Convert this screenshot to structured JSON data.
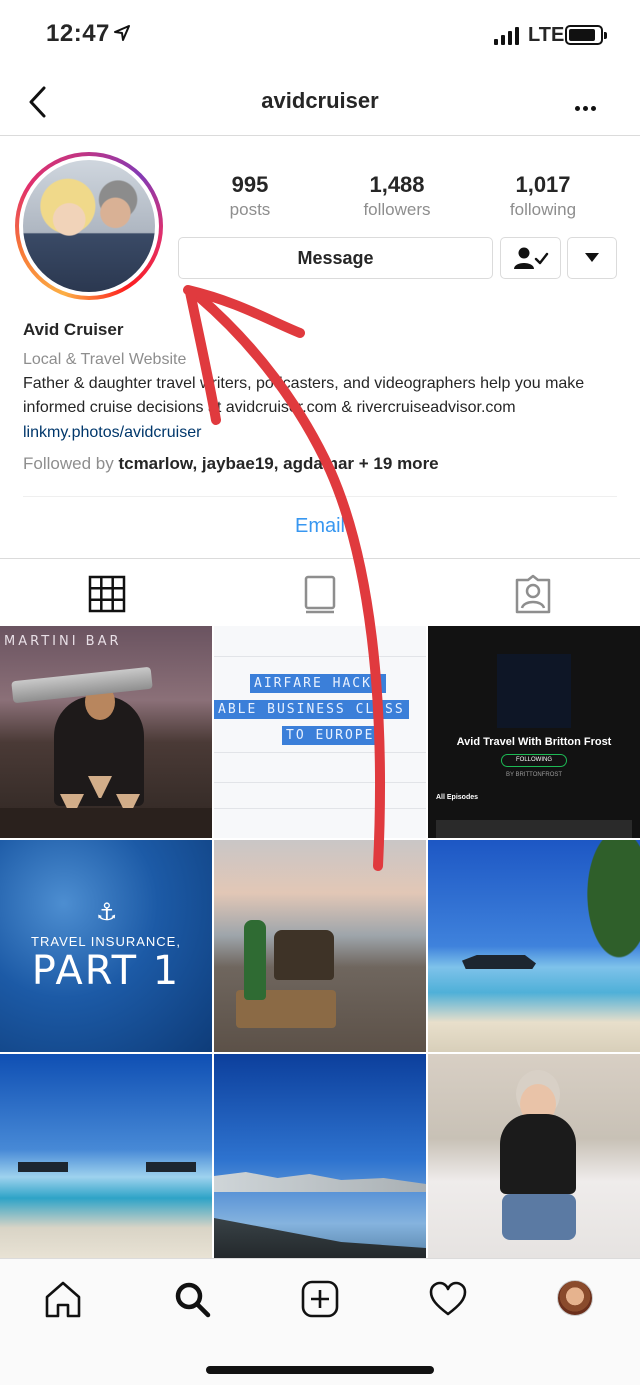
{
  "status_bar": {
    "time": "12:47",
    "network": "LTE"
  },
  "header": {
    "username": "avidcruiser"
  },
  "profile": {
    "stats": [
      {
        "value": "995",
        "label": "posts"
      },
      {
        "value": "1,488",
        "label": "followers"
      },
      {
        "value": "1,017",
        "label": "following"
      }
    ],
    "message_label": "Message",
    "name": "Avid Cruiser",
    "category": "Local & Travel Website",
    "bio": "Father & daughter travel writers, podcasters, and videographers help you make informed cruise decisions at avidcruiser.com & rivercruiseadvisor.com",
    "link": "linkmy.photos/avidcruiser",
    "followed_by": {
      "prefix": "Followed by",
      "names": "tcmarlow, jaybae19, agdamar",
      "suffix": "+ 19 more"
    },
    "email_label": "Email"
  },
  "posts": {
    "martini_sign": "MARTINI BAR",
    "airfare_lines": [
      "AIRFARE HACKS",
      "ABLE BUSINESS CLASS",
      "TO EUROPE"
    ],
    "podcast": {
      "title": "Avid Travel With Britton Frost",
      "button": "FOLLOWING",
      "author": "BY BRITTONFROST",
      "episodes": "All Episodes"
    },
    "insurance_line1": "TRAVEL INSURANCE,",
    "insurance_line2": "PART 1"
  },
  "colors": {
    "link": "#00376b",
    "email": "#3897f0",
    "annotation_arrow": "#e03a3e"
  }
}
